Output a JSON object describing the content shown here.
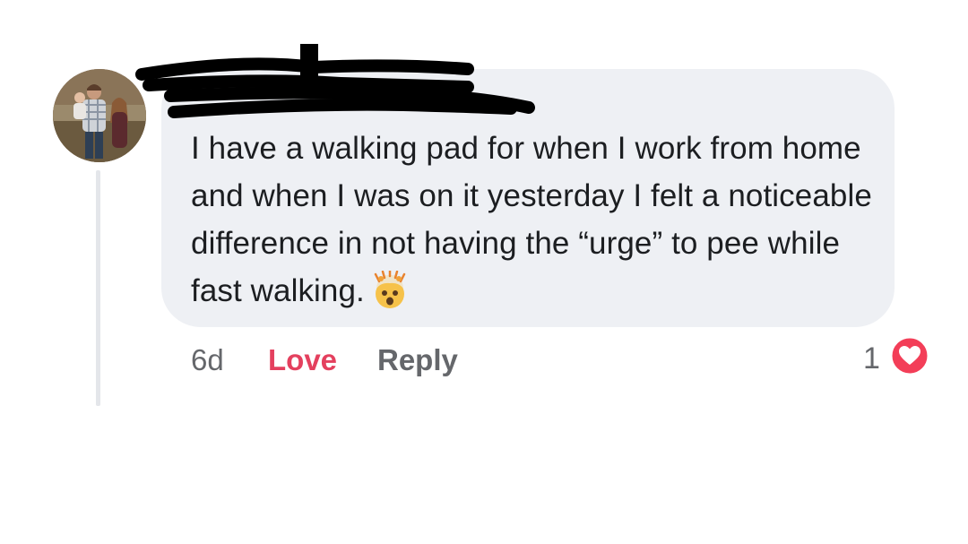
{
  "comment": {
    "author": "",
    "text": "I have a walking pad for when I work from home and when I was on it yesterday I felt a noticeable difference in not having the “urge” to pee while fast walking.",
    "emoji": "exploding-head-emoji"
  },
  "actions": {
    "time": "6d",
    "love_label": "Love",
    "reply_label": "Reply"
  },
  "reactions": {
    "count": "1",
    "icon": "heart-reaction-icon",
    "color": "#f33e58"
  },
  "colors": {
    "bubble": "#eef0f4",
    "love": "#e4405e",
    "muted": "#65676b"
  }
}
